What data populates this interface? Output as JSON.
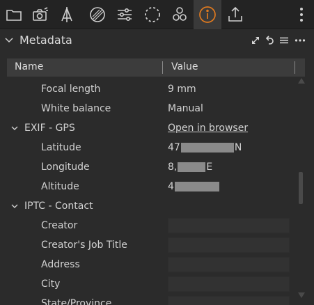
{
  "panel": {
    "title": "Metadata"
  },
  "table": {
    "columns": {
      "name": "Name",
      "value": "Value"
    },
    "rows": [
      {
        "name": "Focal length",
        "value": "9 mm"
      },
      {
        "name": "White balance",
        "value": "Manual"
      },
      {
        "name": "EXIF - GPS",
        "value": "Open in browser"
      },
      {
        "name": "Latitude",
        "value_prefix": "47",
        "value_suffix": "N"
      },
      {
        "name": "Longitude",
        "value_prefix": "8,",
        "value_suffix": "E"
      },
      {
        "name": "Altitude",
        "value_prefix": "4"
      },
      {
        "name": "IPTC - Contact"
      },
      {
        "name": "Creator",
        "value": ""
      },
      {
        "name": "Creator's Job Title",
        "value": ""
      },
      {
        "name": "Address",
        "value": ""
      },
      {
        "name": "City",
        "value": ""
      },
      {
        "name": "State/Province",
        "value": ""
      }
    ]
  },
  "icons": {
    "toolbar": [
      "folder-icon",
      "camera-icon",
      "lens-icon",
      "exposure-icon",
      "sliders-icon",
      "dashed-circle-icon",
      "circles-icon",
      "info-icon",
      "export-icon",
      "more-vertical-icon"
    ],
    "header": [
      "expand-icon",
      "reset-icon",
      "menu-icon",
      "more-horizontal-icon"
    ]
  },
  "colors": {
    "accent": "#e07a1f",
    "background": "#2b2b2b",
    "toolbar": "#232323"
  }
}
